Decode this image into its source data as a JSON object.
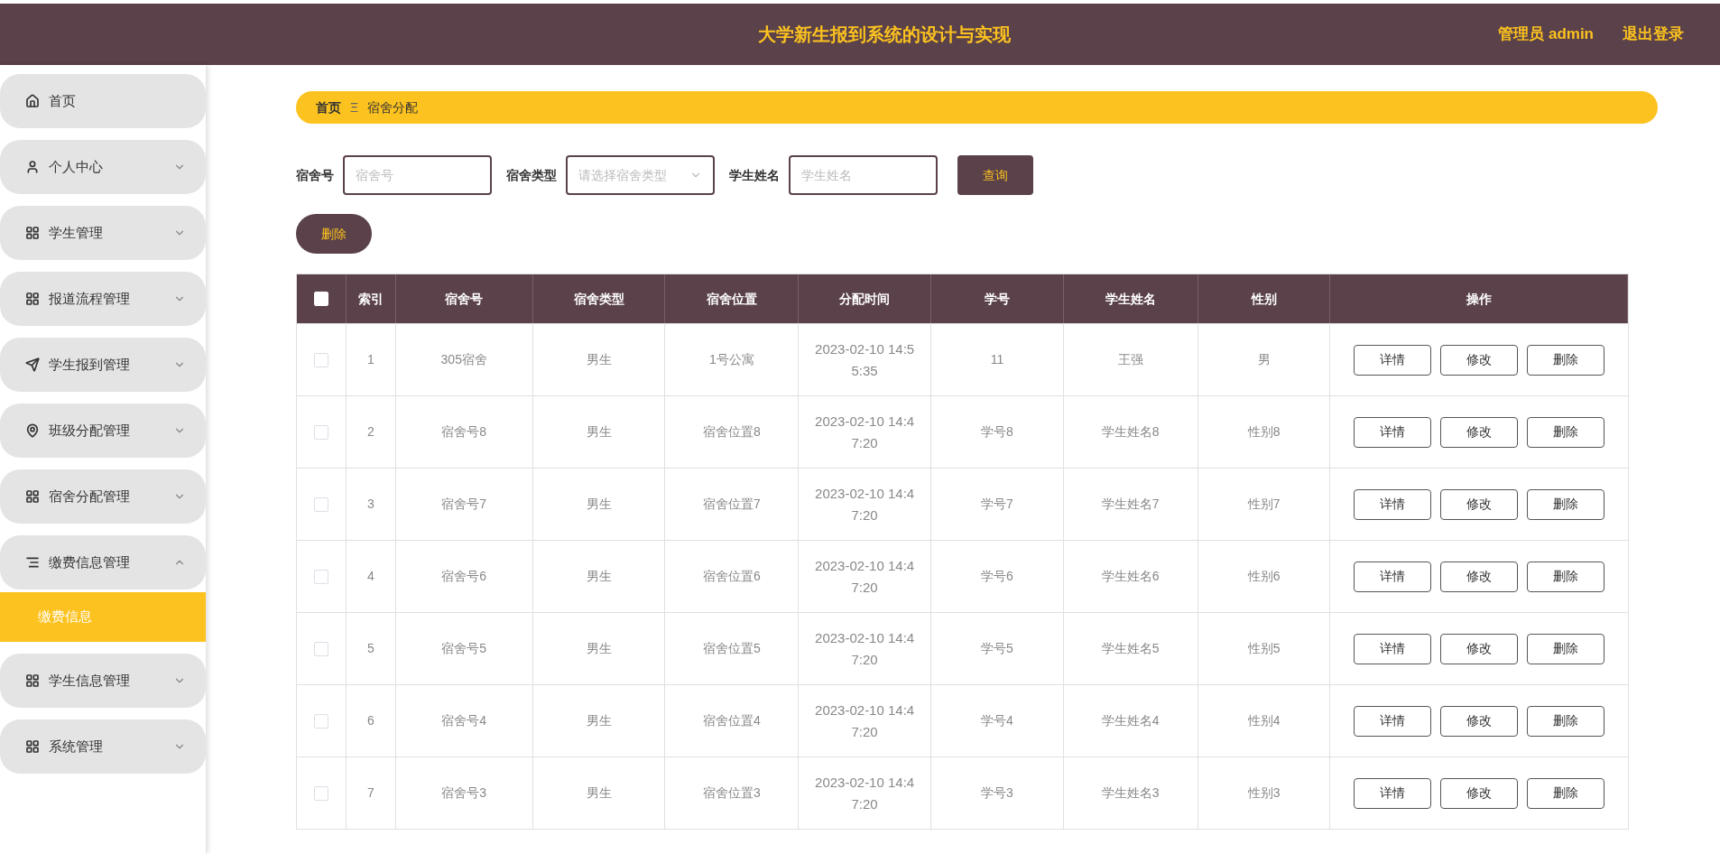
{
  "header": {
    "title": "大学新生报到系统的设计与实现",
    "user": "管理员 admin",
    "logout": "退出登录"
  },
  "sidebar": {
    "items": [
      {
        "label": "首页"
      },
      {
        "label": "个人中心",
        "expanded": false
      },
      {
        "label": "学生管理",
        "expanded": false
      },
      {
        "label": "报道流程管理",
        "expanded": false
      },
      {
        "label": "学生报到管理",
        "expanded": false
      },
      {
        "label": "班级分配管理",
        "expanded": false
      },
      {
        "label": "宿舍分配管理",
        "expanded": false
      },
      {
        "label": "缴费信息管理",
        "expanded": true,
        "children": [
          {
            "label": "缴费信息",
            "selected": true
          }
        ]
      },
      {
        "label": "学生信息管理",
        "expanded": false
      },
      {
        "label": "系统管理",
        "expanded": false
      }
    ]
  },
  "breadcrumb": {
    "home": "首页",
    "separator": "Ξ",
    "current": "宿舍分配"
  },
  "search": {
    "fields": [
      {
        "kind": "input",
        "label": "宿舍号",
        "placeholder": "宿舍号"
      },
      {
        "kind": "select",
        "label": "宿舍类型",
        "placeholder": "请选择宿舍类型"
      },
      {
        "kind": "input",
        "label": "学生姓名",
        "placeholder": "学生姓名"
      }
    ],
    "button": "查询"
  },
  "delete_button": "删除",
  "table": {
    "select_all_checked": false,
    "columns": [
      "索引",
      "宿舍号",
      "宿舍类型",
      "宿舍位置",
      "分配时间",
      "学号",
      "学生姓名",
      "性别",
      "操作"
    ],
    "rows": [
      {
        "checked": false,
        "cells": [
          "1",
          "305宿舍",
          "男生",
          "1号公寓",
          "2023-02-10 14:55:35",
          "11",
          "王强",
          "男"
        ],
        "actions": [
          "详情",
          "修改",
          "删除"
        ]
      },
      {
        "checked": false,
        "cells": [
          "2",
          "宿舍号8",
          "男生",
          "宿舍位置8",
          "2023-02-10 14:47:20",
          "学号8",
          "学生姓名8",
          "性别8"
        ],
        "actions": [
          "详情",
          "修改",
          "删除"
        ]
      },
      {
        "checked": false,
        "cells": [
          "3",
          "宿舍号7",
          "男生",
          "宿舍位置7",
          "2023-02-10 14:47:20",
          "学号7",
          "学生姓名7",
          "性别7"
        ],
        "actions": [
          "详情",
          "修改",
          "删除"
        ]
      },
      {
        "checked": false,
        "cells": [
          "4",
          "宿舍号6",
          "男生",
          "宿舍位置6",
          "2023-02-10 14:47:20",
          "学号6",
          "学生姓名6",
          "性别6"
        ],
        "actions": [
          "详情",
          "修改",
          "删除"
        ]
      },
      {
        "checked": false,
        "cells": [
          "5",
          "宿舍号5",
          "男生",
          "宿舍位置5",
          "2023-02-10 14:47:20",
          "学号5",
          "学生姓名5",
          "性别5"
        ],
        "actions": [
          "详情",
          "修改",
          "删除"
        ]
      },
      {
        "checked": false,
        "cells": [
          "6",
          "宿舍号4",
          "男生",
          "宿舍位置4",
          "2023-02-10 14:47:20",
          "学号4",
          "学生姓名4",
          "性别4"
        ],
        "actions": [
          "详情",
          "修改",
          "删除"
        ]
      },
      {
        "checked": false,
        "cells": [
          "7",
          "宿舍号3",
          "男生",
          "宿舍位置3",
          "2023-02-10 14:47:20",
          "学号3",
          "学生姓名3",
          "性别3"
        ],
        "actions": [
          "详情",
          "修改",
          "删除"
        ]
      }
    ]
  }
}
